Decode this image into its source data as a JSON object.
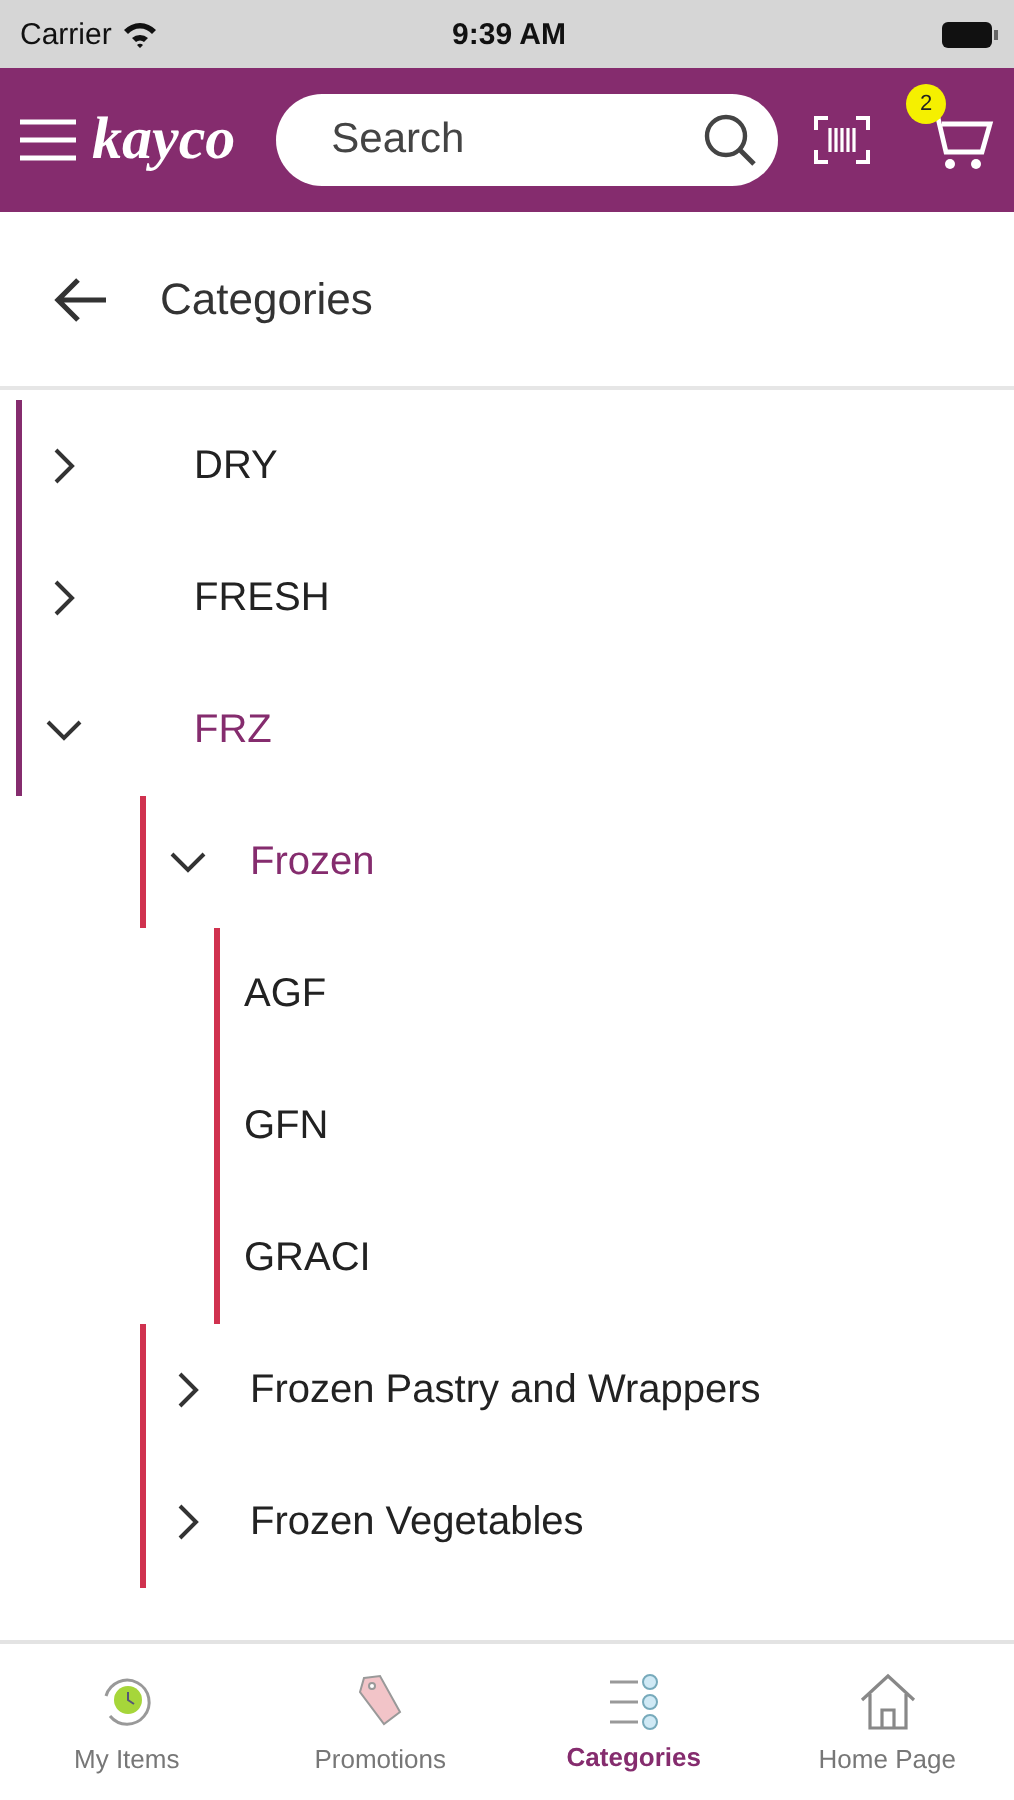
{
  "status_bar": {
    "carrier": "Carrier",
    "time": "9:39 AM"
  },
  "header": {
    "logo": "kayco",
    "search": {
      "placeholder": "Search"
    },
    "cart_count": "2"
  },
  "page": {
    "title": "Categories"
  },
  "categories": [
    {
      "label": "DRY",
      "expanded": false
    },
    {
      "label": "FRESH",
      "expanded": false
    },
    {
      "label": "FRZ",
      "expanded": true,
      "children": [
        {
          "label": "Frozen",
          "expanded": true,
          "children": [
            {
              "label": "AGF"
            },
            {
              "label": "GFN"
            },
            {
              "label": "GRACI"
            }
          ]
        },
        {
          "label": "Frozen Pastry and Wrappers",
          "expanded": false
        },
        {
          "label": "Frozen Vegetables",
          "expanded": false
        }
      ]
    }
  ],
  "tabs": [
    {
      "label": "My Items",
      "selected": false,
      "kind": "items"
    },
    {
      "label": "Promotions",
      "selected": false,
      "kind": "promo"
    },
    {
      "label": "Categories",
      "selected": true,
      "kind": "categories"
    },
    {
      "label": "Home Page",
      "selected": false,
      "kind": "home"
    }
  ]
}
